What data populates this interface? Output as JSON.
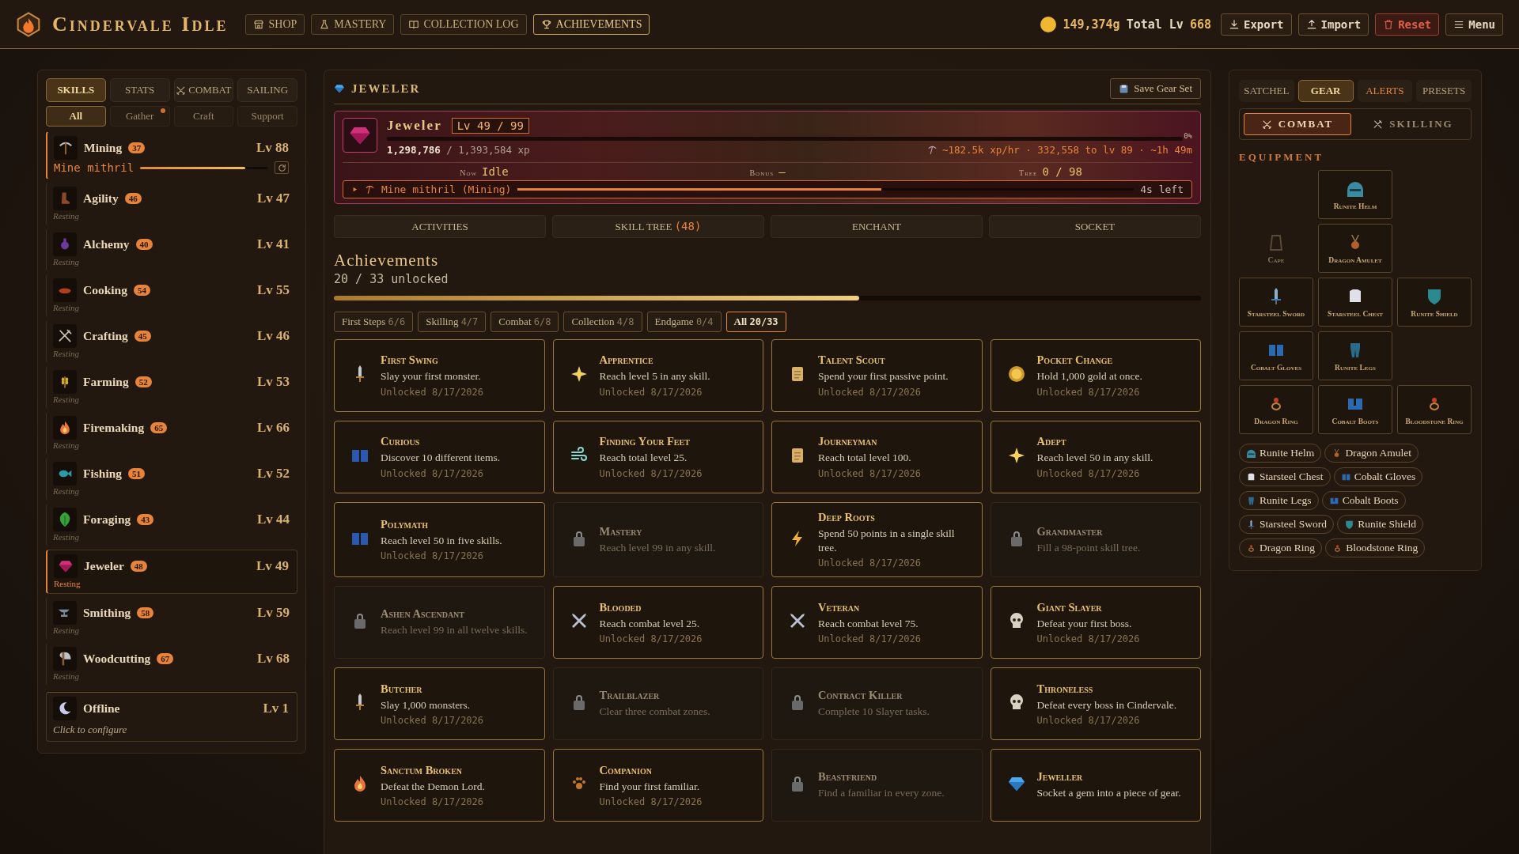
{
  "app": {
    "title": "Cindervale Idle"
  },
  "nav": [
    {
      "label": "SHOP",
      "selected": false
    },
    {
      "label": "MASTERY",
      "selected": false
    },
    {
      "label": "COLLECTION LOG",
      "selected": false
    },
    {
      "label": "ACHIEVEMENTS",
      "selected": true
    }
  ],
  "status": {
    "gold": "149,374g",
    "total_label": "Total Lv",
    "total": "668"
  },
  "actions": [
    {
      "label": "Export",
      "kind": "normal"
    },
    {
      "label": "Import",
      "kind": "normal"
    },
    {
      "label": "Reset",
      "kind": "danger"
    },
    {
      "label": "Menu",
      "kind": "normal"
    }
  ],
  "sidebar": {
    "tabs": [
      {
        "label": "SKILLS",
        "selected": true
      },
      {
        "label": "STATS",
        "selected": false
      },
      {
        "label": "COMBAT",
        "selected": false
      },
      {
        "label": "SAILING",
        "selected": false
      }
    ],
    "filters": [
      {
        "label": "All",
        "selected": true,
        "dot": false
      },
      {
        "label": "Gather",
        "selected": false,
        "dot": true
      },
      {
        "label": "Craft",
        "selected": false,
        "dot": false
      },
      {
        "label": "Support",
        "selected": false,
        "dot": false
      }
    ],
    "skills": [
      {
        "name": "Mining",
        "badge": "37",
        "level_text": "Lv 88",
        "status": "Mine mithril",
        "kind": "active",
        "level": 0.82,
        "selected": false
      },
      {
        "name": "Agility",
        "badge": "46",
        "level_text": "Lv 47",
        "status": "Resting",
        "kind": "resting",
        "selected": false
      },
      {
        "name": "Alchemy",
        "badge": "40",
        "level_text": "Lv 41",
        "status": "Resting",
        "kind": "resting",
        "selected": false
      },
      {
        "name": "Cooking",
        "badge": "54",
        "level_text": "Lv 55",
        "status": "Resting",
        "kind": "resting",
        "selected": false
      },
      {
        "name": "Crafting",
        "badge": "45",
        "level_text": "Lv 46",
        "status": "Resting",
        "kind": "resting",
        "selected": false
      },
      {
        "name": "Farming",
        "badge": "52",
        "level_text": "Lv 53",
        "status": "Resting",
        "kind": "resting",
        "selected": false
      },
      {
        "name": "Firemaking",
        "badge": "65",
        "level_text": "Lv 66",
        "status": "Resting",
        "kind": "resting",
        "selected": false
      },
      {
        "name": "Fishing",
        "badge": "51",
        "level_text": "Lv 52",
        "status": "Resting",
        "kind": "resting",
        "selected": false
      },
      {
        "name": "Foraging",
        "badge": "43",
        "level_text": "Lv 44",
        "status": "Resting",
        "kind": "resting",
        "selected": false
      },
      {
        "name": "Jeweler",
        "badge": "48",
        "level_text": "Lv 49",
        "status": "Resting",
        "kind": "resting",
        "selected": true
      },
      {
        "name": "Smithing",
        "badge": "58",
        "level_text": "Lv 59",
        "status": "Resting",
        "kind": "resting",
        "selected": false
      },
      {
        "name": "Woodcutting",
        "badge": "67",
        "level_text": "Lv 68",
        "status": "Resting",
        "kind": "resting",
        "selected": false
      },
      {
        "name": "Offline",
        "level_text": "Lv 1",
        "status": "Click to configure",
        "kind": "offline",
        "selected": false
      }
    ]
  },
  "main": {
    "header": "JEWELER",
    "save_button": "Save Gear Set",
    "hero": {
      "name": "Jeweler",
      "level_text": "Lv 49 / 99",
      "xp": "1,298,786",
      "xp_total": "/ 1,393,584 xp",
      "percent": "0%",
      "level": 0.0,
      "rate": "~182.5k xp/hr · 332,558 to lv 89 · ~1h 49m",
      "stats": [
        {
          "label": "Now",
          "value": "Idle"
        },
        {
          "label": "Bonus",
          "value": "—"
        },
        {
          "label": "Tree",
          "value": "0 / 98"
        }
      ],
      "action": {
        "label": "Mine mithril (Mining)",
        "level": 0.59,
        "remaining": "4s left"
      }
    },
    "tabs": [
      {
        "label": "ACTIVITIES",
        "selected": false
      },
      {
        "label": "SKILL TREE",
        "count": "(48)",
        "selected": false
      },
      {
        "label": "ENCHANT",
        "selected": false
      },
      {
        "label": "SOCKET",
        "selected": false
      }
    ],
    "achievements": {
      "title": "Achievements",
      "summary": "20 / 33 unlocked",
      "level": 0.606,
      "filters": [
        {
          "label": "First Steps",
          "count": "6/6",
          "selected": false
        },
        {
          "label": "Skilling",
          "count": "4/7",
          "selected": false
        },
        {
          "label": "Combat",
          "count": "6/8",
          "selected": false
        },
        {
          "label": "Collection",
          "count": "4/8",
          "selected": false
        },
        {
          "label": "Endgame",
          "count": "0/4",
          "selected": false
        },
        {
          "label": "All",
          "count": "20/33",
          "selected": true
        }
      ],
      "cards": [
        {
          "title": "First Swing",
          "description": "Slay your first monster.",
          "unlocked": true,
          "date": "Unlocked 8/17/2026"
        },
        {
          "title": "Apprentice",
          "description": "Reach level 5 in any skill.",
          "unlocked": true,
          "date": "Unlocked 8/17/2026"
        },
        {
          "title": "Talent Scout",
          "description": "Spend your first passive point.",
          "unlocked": true,
          "date": "Unlocked 8/17/2026"
        },
        {
          "title": "Pocket Change",
          "description": "Hold 1,000 gold at once.",
          "unlocked": true,
          "date": "Unlocked 8/17/2026"
        },
        {
          "title": "Curious",
          "description": "Discover 10 different items.",
          "unlocked": true,
          "date": "Unlocked 8/17/2026"
        },
        {
          "title": "Finding Your Feet",
          "description": "Reach total level 25.",
          "unlocked": true,
          "date": "Unlocked 8/17/2026"
        },
        {
          "title": "Journeyman",
          "description": "Reach total level 100.",
          "unlocked": true,
          "date": "Unlocked 8/17/2026"
        },
        {
          "title": "Adept",
          "description": "Reach level 50 in any skill.",
          "unlocked": true,
          "date": "Unlocked 8/17/2026"
        },
        {
          "title": "Polymath",
          "description": "Reach level 50 in five skills.",
          "unlocked": true,
          "date": "Unlocked 8/17/2026"
        },
        {
          "title": "Mastery",
          "description": "Reach level 99 in any skill.",
          "unlocked": false
        },
        {
          "title": "Deep Roots",
          "description": "Spend 50 points in a single skill tree.",
          "unlocked": true,
          "date": "Unlocked 8/17/2026"
        },
        {
          "title": "Grandmaster",
          "description": "Fill a 98-point skill tree.",
          "unlocked": false
        },
        {
          "title": "Ashen Ascendant",
          "description": "Reach level 99 in all twelve skills.",
          "unlocked": false
        },
        {
          "title": "Blooded",
          "description": "Reach combat level 25.",
          "unlocked": true,
          "date": "Unlocked 8/17/2026"
        },
        {
          "title": "Veteran",
          "description": "Reach combat level 75.",
          "unlocked": true,
          "date": "Unlocked 8/17/2026"
        },
        {
          "title": "Giant Slayer",
          "description": "Defeat your first boss.",
          "unlocked": true,
          "date": "Unlocked 8/17/2026"
        },
        {
          "title": "Butcher",
          "description": "Slay 1,000 monsters.",
          "unlocked": true,
          "date": "Unlocked 8/17/2026"
        },
        {
          "title": "Trailblazer",
          "description": "Clear three combat zones.",
          "unlocked": false
        },
        {
          "title": "Contract Killer",
          "description": "Complete 10 Slayer tasks.",
          "unlocked": false
        },
        {
          "title": "Throneless",
          "description": "Defeat every boss in Cindervale.",
          "unlocked": true,
          "date": "Unlocked 8/17/2026"
        },
        {
          "title": "Sanctum Broken",
          "description": "Defeat the Demon Lord.",
          "unlocked": true,
          "date": "Unlocked 8/17/2026"
        },
        {
          "title": "Companion",
          "description": "Find your first familiar.",
          "unlocked": true,
          "date": "Unlocked 8/17/2026"
        },
        {
          "title": "Beastfriend",
          "description": "Find a familiar in every zone.",
          "unlocked": false
        },
        {
          "title": "Jeweller",
          "description": "Socket a gem into a piece of gear.",
          "unlocked": true
        }
      ]
    }
  },
  "gear": {
    "tabs": [
      {
        "label": "SATCHEL",
        "selected": false,
        "alert": false
      },
      {
        "label": "GEAR",
        "selected": true,
        "alert": false
      },
      {
        "label": "ALERTS",
        "selected": false,
        "alert": true
      },
      {
        "label": "PRESETS",
        "selected": false,
        "alert": false
      }
    ],
    "modes": [
      {
        "label": "COMBAT",
        "selected": true
      },
      {
        "label": "SKILLING",
        "selected": false
      }
    ],
    "section": "EQUIPMENT",
    "slots": [
      {
        "kind": "head",
        "label": "Runite Helm",
        "equipped": true
      },
      {
        "kind": "back",
        "label": "Cape",
        "equipped": false
      },
      {
        "kind": "neck",
        "label": "Dragon Amulet",
        "equipped": true
      },
      {
        "kind": "weapon",
        "label": "Starsteel Sword",
        "equipped": true
      },
      {
        "kind": "body",
        "label": "Starsteel Chest",
        "equipped": true
      },
      {
        "kind": "offhand",
        "label": "Runite Shield",
        "equipped": true
      },
      {
        "kind": "hands",
        "label": "Cobalt Gloves",
        "equipped": true
      },
      {
        "kind": "legs",
        "label": "Runite Legs",
        "equipped": true
      },
      {
        "kind": "ring",
        "label": "Dragon Ring",
        "equipped": true
      },
      {
        "kind": "feet",
        "label": "Cobalt Boots",
        "equipped": true
      },
      {
        "kind": "ring2",
        "label": "Bloodstone Ring",
        "equipped": true
      }
    ],
    "chips": [
      "Runite Helm",
      "Dragon Amulet",
      "Starsteel Chest",
      "Cobalt Gloves",
      "Runite Legs",
      "Cobalt Boots",
      "Starsteel Sword",
      "Runite Shield",
      "Dragon Ring",
      "Bloodstone Ring"
    ]
  }
}
